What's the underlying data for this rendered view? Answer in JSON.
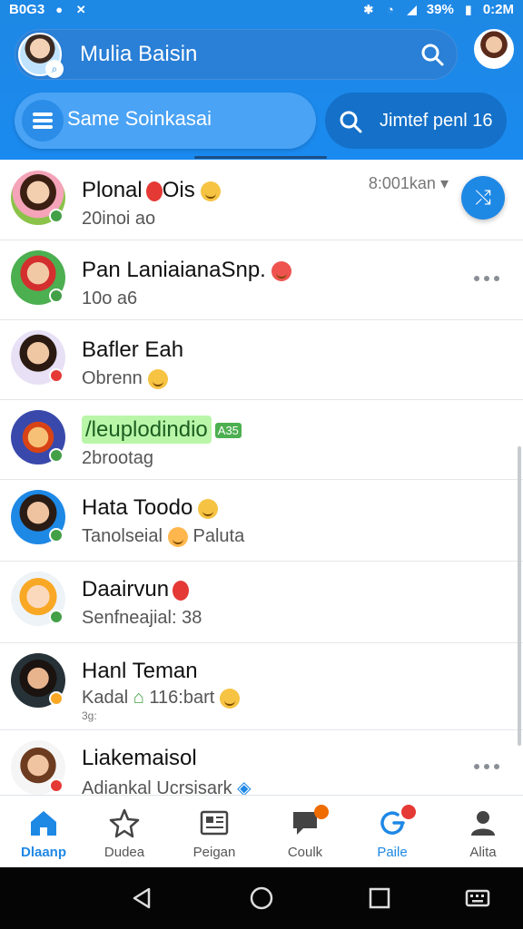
{
  "status_bar": {
    "left_text": "B0G3",
    "time": "0:2M",
    "battery_text": "39%"
  },
  "header": {
    "search_title": "Mulia Baisin",
    "chip_left_label": "Same Soinkasai",
    "chip_right_label": "Jimtef penl 16"
  },
  "chats": [
    {
      "name": "Plonal",
      "name_suffix": "Ois",
      "sub": "20inoi ao",
      "time": "8:001kan",
      "status_color": "#43a047"
    },
    {
      "name": "Pan LaniaianaSnp.",
      "sub": "10o a6",
      "status_color": "#43a047"
    },
    {
      "name": "Bafler Eah",
      "sub": "Obrenn",
      "status_color": "#e53935"
    },
    {
      "name": "/leuplodindio",
      "name_tag": "A35",
      "sub": "2brootag",
      "status_color": "#43a047"
    },
    {
      "name": "Hata Toodo",
      "sub": "Tanolseial",
      "sub_suffix": "Paluta",
      "status_color": "#43a047"
    },
    {
      "name": "Daairvun",
      "sub": "Senfneajial: 38",
      "status_color": "#43a047"
    },
    {
      "name": "Hanl Teman",
      "sub": "Kadal",
      "sub_mid": "116:bart",
      "sub_extra": "3g:",
      "status_color": "#f9a825"
    },
    {
      "name": "Liakemaisol",
      "sub": "Adiankal Ucrsisark",
      "status_color": "#e53935"
    }
  ],
  "tabs": [
    {
      "label": "Dlaanp",
      "icon": "home-icon",
      "active": true
    },
    {
      "label": "Dudea",
      "icon": "star-icon",
      "active": false
    },
    {
      "label": "Peigan",
      "icon": "newspaper-icon",
      "active": false
    },
    {
      "label": "Coulk",
      "icon": "chat-bubble-icon",
      "active": false
    },
    {
      "label": "Paile",
      "icon": "refresh-icon",
      "active": false
    },
    {
      "label": "Alita",
      "icon": "person-icon",
      "active": false
    }
  ],
  "colors": {
    "brand": "#1e88e5",
    "brand_dark": "#1470c8"
  }
}
